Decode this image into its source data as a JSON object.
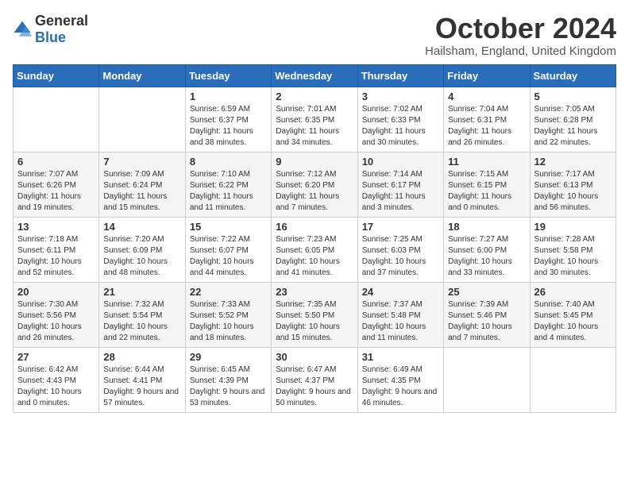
{
  "logo": {
    "general": "General",
    "blue": "Blue"
  },
  "header": {
    "month": "October 2024",
    "location": "Hailsham, England, United Kingdom"
  },
  "weekdays": [
    "Sunday",
    "Monday",
    "Tuesday",
    "Wednesday",
    "Thursday",
    "Friday",
    "Saturday"
  ],
  "weeks": [
    [
      {
        "day": "",
        "info": ""
      },
      {
        "day": "",
        "info": ""
      },
      {
        "day": "1",
        "info": "Sunrise: 6:59 AM\nSunset: 6:37 PM\nDaylight: 11 hours and 38 minutes."
      },
      {
        "day": "2",
        "info": "Sunrise: 7:01 AM\nSunset: 6:35 PM\nDaylight: 11 hours and 34 minutes."
      },
      {
        "day": "3",
        "info": "Sunrise: 7:02 AM\nSunset: 6:33 PM\nDaylight: 11 hours and 30 minutes."
      },
      {
        "day": "4",
        "info": "Sunrise: 7:04 AM\nSunset: 6:31 PM\nDaylight: 11 hours and 26 minutes."
      },
      {
        "day": "5",
        "info": "Sunrise: 7:05 AM\nSunset: 6:28 PM\nDaylight: 11 hours and 22 minutes."
      }
    ],
    [
      {
        "day": "6",
        "info": "Sunrise: 7:07 AM\nSunset: 6:26 PM\nDaylight: 11 hours and 19 minutes."
      },
      {
        "day": "7",
        "info": "Sunrise: 7:09 AM\nSunset: 6:24 PM\nDaylight: 11 hours and 15 minutes."
      },
      {
        "day": "8",
        "info": "Sunrise: 7:10 AM\nSunset: 6:22 PM\nDaylight: 11 hours and 11 minutes."
      },
      {
        "day": "9",
        "info": "Sunrise: 7:12 AM\nSunset: 6:20 PM\nDaylight: 11 hours and 7 minutes."
      },
      {
        "day": "10",
        "info": "Sunrise: 7:14 AM\nSunset: 6:17 PM\nDaylight: 11 hours and 3 minutes."
      },
      {
        "day": "11",
        "info": "Sunrise: 7:15 AM\nSunset: 6:15 PM\nDaylight: 11 hours and 0 minutes."
      },
      {
        "day": "12",
        "info": "Sunrise: 7:17 AM\nSunset: 6:13 PM\nDaylight: 10 hours and 56 minutes."
      }
    ],
    [
      {
        "day": "13",
        "info": "Sunrise: 7:18 AM\nSunset: 6:11 PM\nDaylight: 10 hours and 52 minutes."
      },
      {
        "day": "14",
        "info": "Sunrise: 7:20 AM\nSunset: 6:09 PM\nDaylight: 10 hours and 48 minutes."
      },
      {
        "day": "15",
        "info": "Sunrise: 7:22 AM\nSunset: 6:07 PM\nDaylight: 10 hours and 44 minutes."
      },
      {
        "day": "16",
        "info": "Sunrise: 7:23 AM\nSunset: 6:05 PM\nDaylight: 10 hours and 41 minutes."
      },
      {
        "day": "17",
        "info": "Sunrise: 7:25 AM\nSunset: 6:03 PM\nDaylight: 10 hours and 37 minutes."
      },
      {
        "day": "18",
        "info": "Sunrise: 7:27 AM\nSunset: 6:00 PM\nDaylight: 10 hours and 33 minutes."
      },
      {
        "day": "19",
        "info": "Sunrise: 7:28 AM\nSunset: 5:58 PM\nDaylight: 10 hours and 30 minutes."
      }
    ],
    [
      {
        "day": "20",
        "info": "Sunrise: 7:30 AM\nSunset: 5:56 PM\nDaylight: 10 hours and 26 minutes."
      },
      {
        "day": "21",
        "info": "Sunrise: 7:32 AM\nSunset: 5:54 PM\nDaylight: 10 hours and 22 minutes."
      },
      {
        "day": "22",
        "info": "Sunrise: 7:33 AM\nSunset: 5:52 PM\nDaylight: 10 hours and 18 minutes."
      },
      {
        "day": "23",
        "info": "Sunrise: 7:35 AM\nSunset: 5:50 PM\nDaylight: 10 hours and 15 minutes."
      },
      {
        "day": "24",
        "info": "Sunrise: 7:37 AM\nSunset: 5:48 PM\nDaylight: 10 hours and 11 minutes."
      },
      {
        "day": "25",
        "info": "Sunrise: 7:39 AM\nSunset: 5:46 PM\nDaylight: 10 hours and 7 minutes."
      },
      {
        "day": "26",
        "info": "Sunrise: 7:40 AM\nSunset: 5:45 PM\nDaylight: 10 hours and 4 minutes."
      }
    ],
    [
      {
        "day": "27",
        "info": "Sunrise: 6:42 AM\nSunset: 4:43 PM\nDaylight: 10 hours and 0 minutes."
      },
      {
        "day": "28",
        "info": "Sunrise: 6:44 AM\nSunset: 4:41 PM\nDaylight: 9 hours and 57 minutes."
      },
      {
        "day": "29",
        "info": "Sunrise: 6:45 AM\nSunset: 4:39 PM\nDaylight: 9 hours and 53 minutes."
      },
      {
        "day": "30",
        "info": "Sunrise: 6:47 AM\nSunset: 4:37 PM\nDaylight: 9 hours and 50 minutes."
      },
      {
        "day": "31",
        "info": "Sunrise: 6:49 AM\nSunset: 4:35 PM\nDaylight: 9 hours and 46 minutes."
      },
      {
        "day": "",
        "info": ""
      },
      {
        "day": "",
        "info": ""
      }
    ]
  ]
}
